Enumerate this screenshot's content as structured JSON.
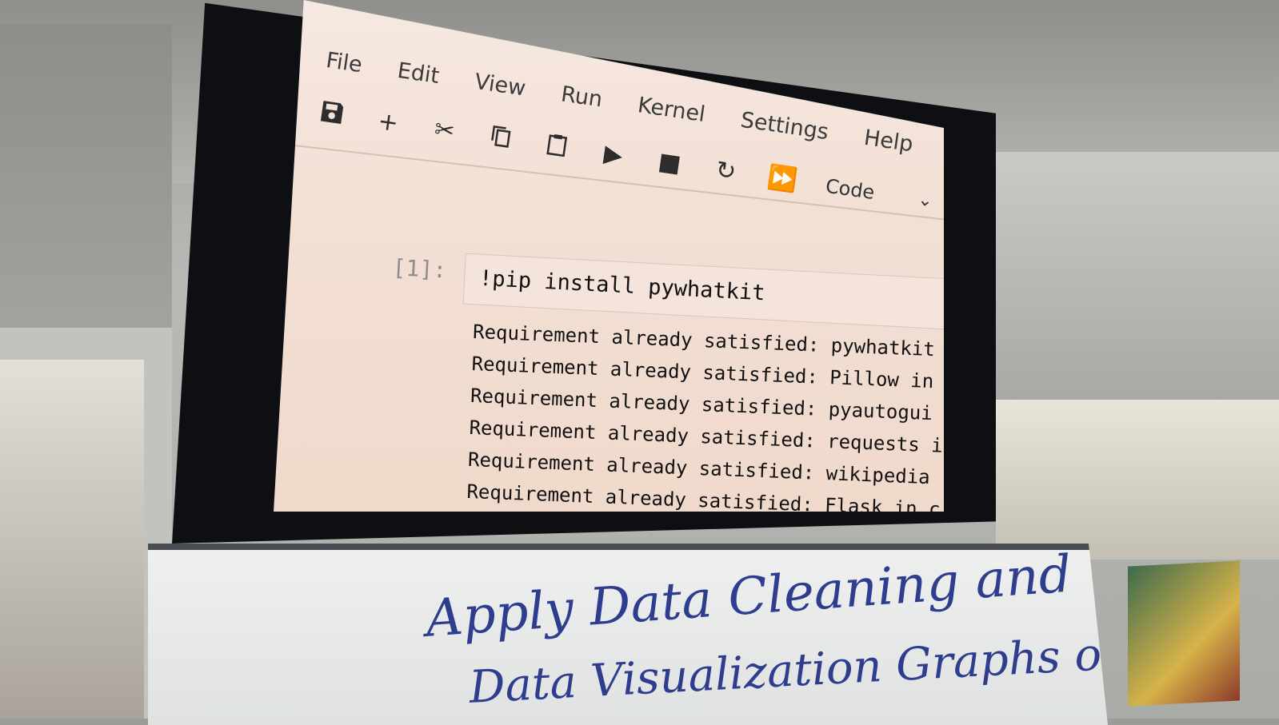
{
  "menubar": {
    "items": [
      "File",
      "Edit",
      "View",
      "Run",
      "Kernel",
      "Settings",
      "Help"
    ]
  },
  "toolbar": {
    "icons": [
      "save-icon",
      "plus-icon",
      "cut-icon",
      "copy-icon",
      "paste-icon",
      "play-icon",
      "stop-icon",
      "restart-icon",
      "fast-forward-icon"
    ],
    "cell_type": "Code"
  },
  "cell": {
    "prompt": "[1]:",
    "code": "!pip install pywhatkit",
    "output": [
      "Requirement already satisfied: pywhatkit",
      "Requirement already satisfied: Pillow in",
      "Requirement already satisfied: pyautogui",
      "Requirement already satisfied: requests i",
      "Requirement already satisfied: wikipedia",
      "Requirement already satisfied: Flask in c"
    ]
  },
  "whiteboard": {
    "line1": "Apply Data Cleaning and",
    "line2": "Data Visualization Graphs on"
  }
}
